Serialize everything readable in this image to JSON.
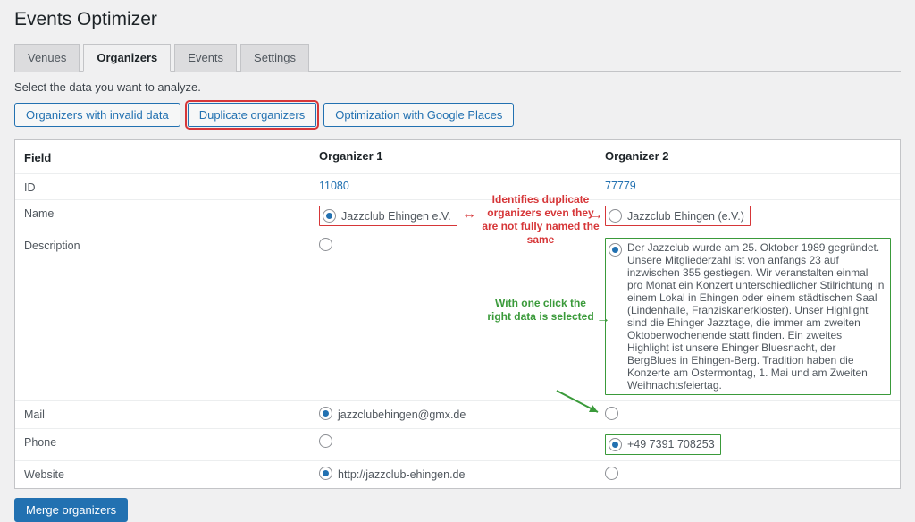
{
  "title": "Events Optimizer",
  "tabs": {
    "venues": "Venues",
    "organizers": "Organizers",
    "events": "Events",
    "settings": "Settings"
  },
  "instruction": "Select the data you want to analyze.",
  "buttons": {
    "invalid": "Organizers with invalid data",
    "duplicate": "Duplicate organizers",
    "google": "Optimization with Google Places",
    "merge": "Merge organizers"
  },
  "headers": {
    "field": "Field",
    "org1": "Organizer 1",
    "org2": "Organizer 2"
  },
  "fields": {
    "id": "ID",
    "name": "Name",
    "description": "Description",
    "mail": "Mail",
    "phone": "Phone",
    "website": "Website"
  },
  "org1": {
    "id": "11080",
    "name": "Jazzclub Ehingen e.V.",
    "description": "",
    "mail": "jazzclubehingen@gmx.de",
    "phone": "",
    "website": "http://jazzclub-ehingen.de"
  },
  "org2": {
    "id": "77779",
    "name": "Jazzclub Ehingen (e.V.)",
    "description": "Der Jazzclub wurde am 25. Oktober 1989 gegründet. Unsere Mitgliederzahl ist von anfangs 23 auf inzwischen 355 gestiegen. Wir veranstalten einmal pro Monat ein Konzert unterschiedlicher Stilrichtung in einem Lokal in Ehingen oder einem städtischen Saal (Lindenhalle, Franziskanerkloster). Unser Highlight sind die Ehinger Jazztage, die immer am zweiten Oktoberwochenende statt finden. Ein zweites Highlight ist unsere Ehinger Bluesnacht, der BergBlues in Ehingen-Berg. Tradition haben die Konzerte am Ostermontag, 1. Mai und am Zweiten Weihnachtsfeiertag.",
    "mail": "",
    "phone": "+49 7391 708253",
    "website": ""
  },
  "annotations": {
    "red": "Identifies duplicate organizers even they are not fully named the same",
    "green": "With one click the right data is selected"
  }
}
